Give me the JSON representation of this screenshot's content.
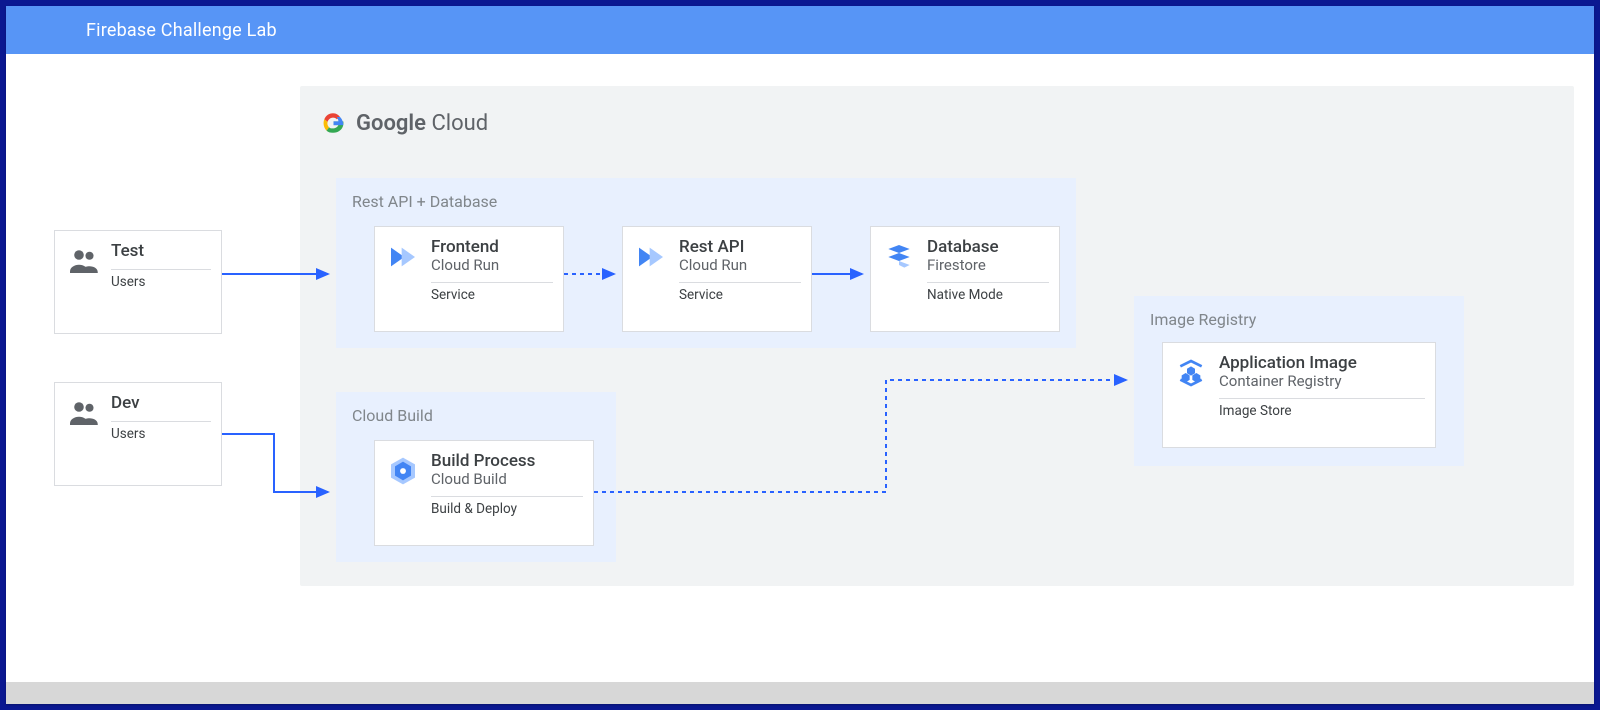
{
  "header": {
    "title": "Firebase Challenge Lab"
  },
  "brand": {
    "word_strong": "Google",
    "word_light": "Cloud"
  },
  "users": {
    "test": {
      "label": "Test",
      "sublabel": "Users"
    },
    "dev": {
      "label": "Dev",
      "sublabel": "Users"
    }
  },
  "groups": {
    "api_db": {
      "title": "Rest API + Database"
    },
    "cloud_build": {
      "title": "Cloud Build"
    },
    "image_registry": {
      "title": "Image Registry"
    }
  },
  "nodes": {
    "frontend": {
      "title": "Frontend",
      "subtitle": "Cloud Run",
      "footer": "Service"
    },
    "rest_api": {
      "title": "Rest API",
      "subtitle": "Cloud Run",
      "footer": "Service"
    },
    "database": {
      "title": "Database",
      "subtitle": "Firestore",
      "footer": "Native Mode"
    },
    "build": {
      "title": "Build Process",
      "subtitle": "Cloud Build",
      "footer": "Build & Deploy"
    },
    "app_image": {
      "title": "Application Image",
      "subtitle": "Container Registry",
      "footer": "Image Store"
    }
  },
  "colors": {
    "accent": "#2962ff",
    "header": "#5795f6",
    "group_bg": "#e8f0fe",
    "panel_bg": "#f1f3f4"
  }
}
